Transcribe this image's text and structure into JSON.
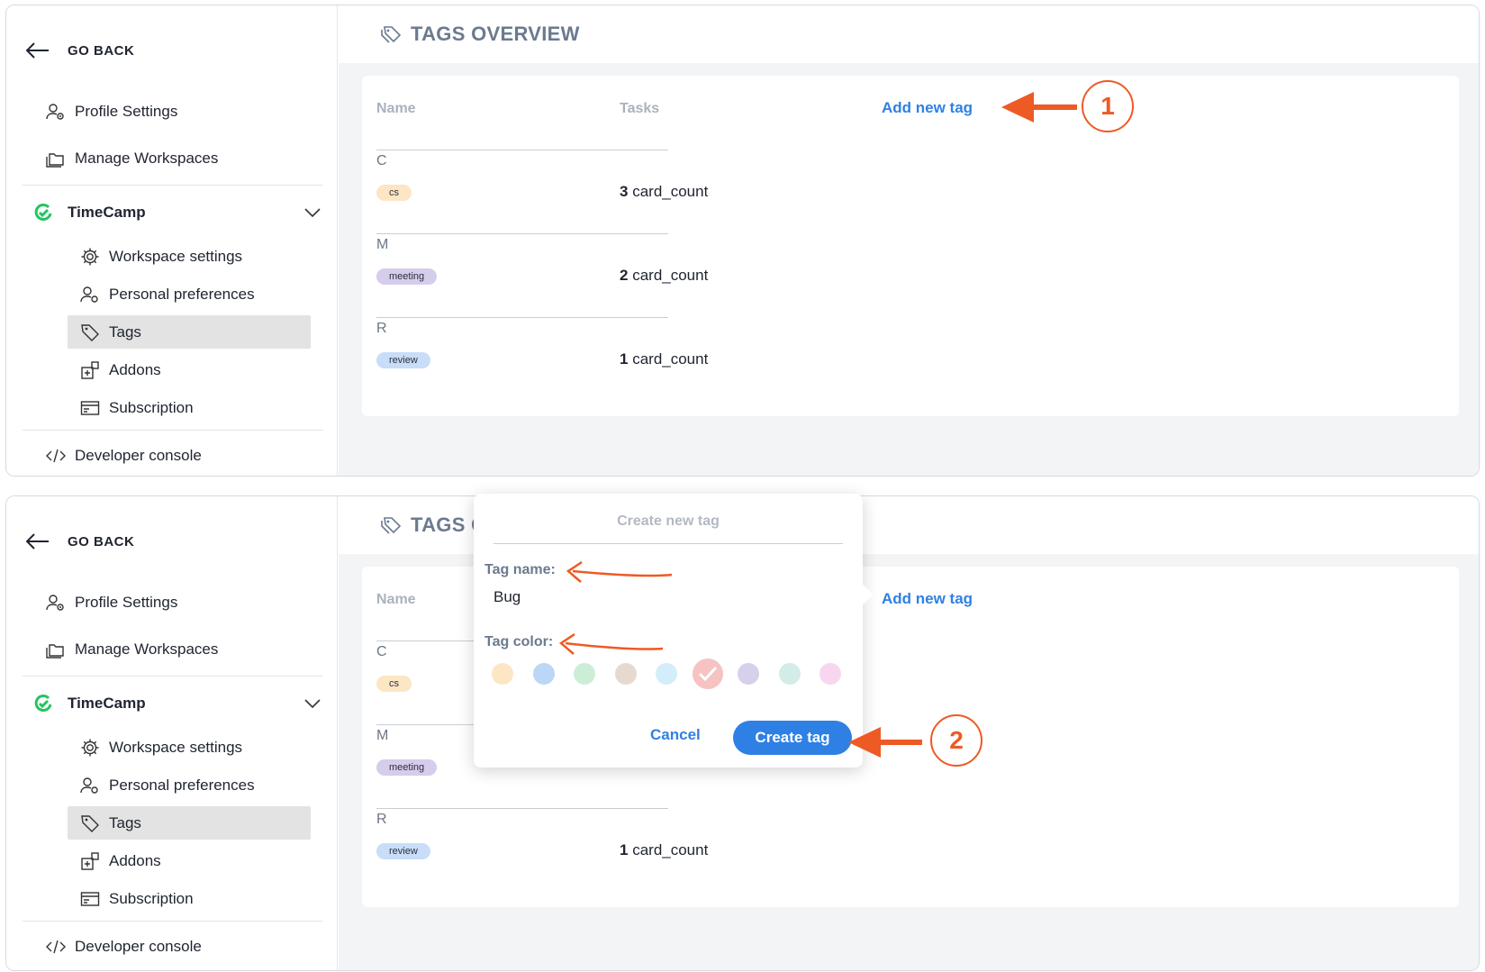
{
  "sidebar": {
    "go_back": "GO BACK",
    "profile_settings": "Profile Settings",
    "manage_workspaces": "Manage Workspaces",
    "workspace_name": "TimeCamp",
    "items": [
      {
        "label": "Workspace settings",
        "icon": "gear-icon"
      },
      {
        "label": "Personal preferences",
        "icon": "user-gear-icon"
      },
      {
        "label": "Tags",
        "icon": "tag-icon",
        "active": true
      },
      {
        "label": "Addons",
        "icon": "addons-icon"
      },
      {
        "label": "Subscription",
        "icon": "card-icon"
      }
    ],
    "developer_console": "Developer console"
  },
  "header": {
    "title": "TAGS OVERVIEW",
    "title_partial": "TAGS C"
  },
  "table": {
    "col_name": "Name",
    "col_tasks": "Tasks",
    "add_new_tag": "Add new tag",
    "groups": [
      {
        "letter": "C",
        "tag": "cs",
        "count": "3",
        "unit": "card_count"
      },
      {
        "letter": "M",
        "tag": "meeting",
        "count": "2",
        "unit": "card_count"
      },
      {
        "letter": "R",
        "tag": "review",
        "count": "1",
        "unit": "card_count"
      }
    ]
  },
  "popup": {
    "title": "Create new tag",
    "tag_name_label": "Tag name:",
    "tag_name_value": "Bug",
    "tag_color_label": "Tag color:",
    "swatch_colors": [
      "#fde6c4",
      "#bcd6f6",
      "#cdeed6",
      "#e6d9cf",
      "#d3eefa",
      "#f6c2c2",
      "#d6d0ea",
      "#d4ece8",
      "#f8d6f0"
    ],
    "selected_swatch": 5,
    "cancel": "Cancel",
    "create": "Create tag"
  },
  "annotations": {
    "step1": "1",
    "step2": "2",
    "accent": "#ee5a24"
  },
  "colors": {
    "link_blue": "#2f80e4",
    "active_bg": "#e3e3e3",
    "brand_green": "#22c55e"
  }
}
